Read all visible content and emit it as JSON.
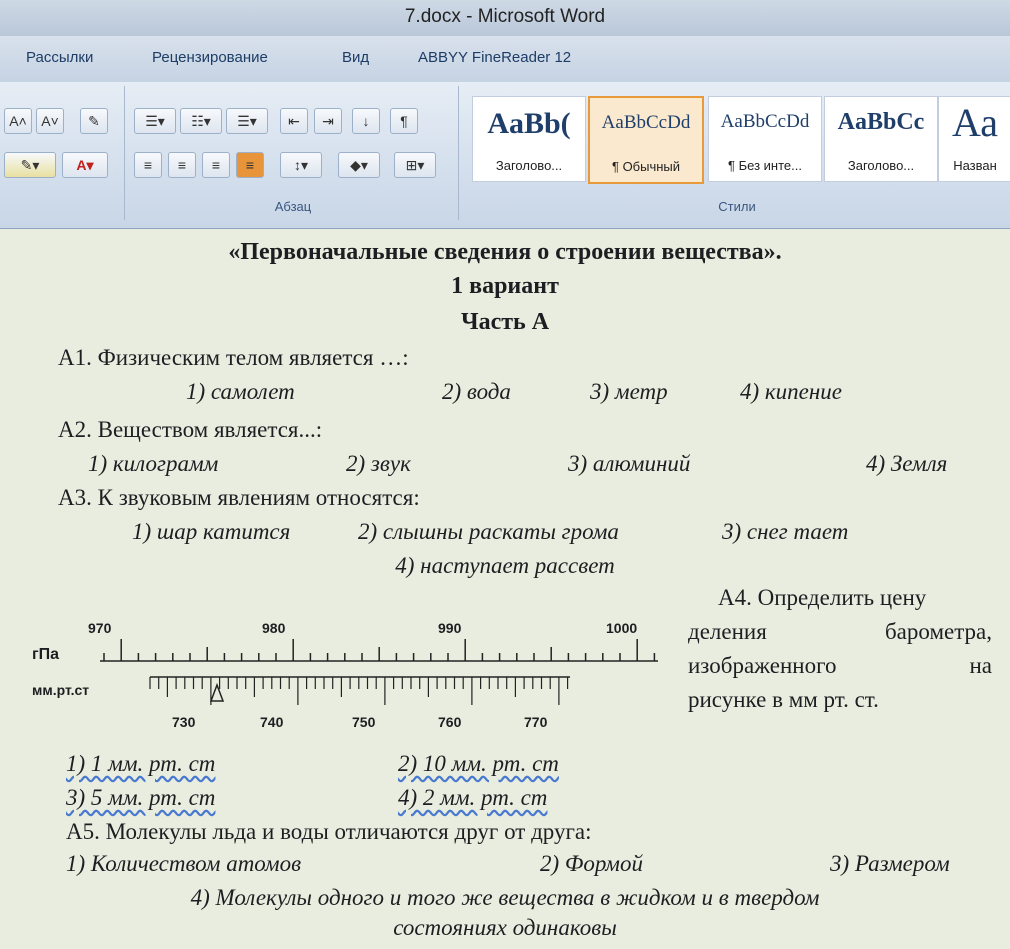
{
  "window": {
    "title": "7.docx - Microsoft Word"
  },
  "ribbon": {
    "tabs": [
      "Рассылки",
      "Рецензирование",
      "Вид",
      "ABBYY FineReader 12"
    ],
    "paragraph_group_label": "Абзац",
    "styles_group_label": "Стили",
    "styles": [
      {
        "preview": "AaBb(",
        "name": "Заголово..."
      },
      {
        "preview": "AaBbCcDd",
        "name": "¶ Обычный"
      },
      {
        "preview": "AaBbCcDd",
        "name": "¶ Без инте..."
      },
      {
        "preview": "AaBbCc",
        "name": "Заголово..."
      },
      {
        "preview": "Аа",
        "name": "Назван"
      }
    ]
  },
  "document": {
    "title": "«Первоначальные сведения о строении вещества».",
    "variant": "1 вариант",
    "part": "Часть А",
    "questions": [
      {
        "label": "А1. Физическим телом является …:",
        "options": [
          "1) самолет",
          "2) вода",
          "3) метр",
          "4) кипение"
        ]
      },
      {
        "label": "А2. Веществом является...:",
        "options": [
          "1) килограмм",
          "2) звук",
          "3) алюминий",
          "4) Земля"
        ]
      },
      {
        "label": "А3. К звуковым явлениям относятся:",
        "options": [
          "1) шар катится",
          "2) слышны раскаты грома",
          "3) снег тает",
          "4) наступает рассвет"
        ]
      },
      {
        "label_lines": [
          "А4. Определить цену",
          "деления барометра,",
          "изображенного на",
          "рисунке в мм рт. ст."
        ],
        "options": [
          "1) 1 мм. рт. ст",
          "2) 10 мм. рт. ст",
          "3) 5 мм. рт. ст",
          "4) 2 мм. рт. ст"
        ]
      },
      {
        "label": "А5. Молекулы льда и воды отличаются друг от друга:",
        "options": [
          "1) Количеством атомов",
          "2) Формой",
          "3) Размером",
          "4) Молекулы одного и того же вещества в жидком и в твердом",
          "состояниях одинаковы"
        ]
      }
    ],
    "barometer": {
      "top_unit": "гПа",
      "bottom_unit": "мм.рт.ст",
      "top_labels": [
        "970",
        "980",
        "990",
        "1000"
      ],
      "bottom_labels": [
        "730",
        "740",
        "750",
        "760",
        "770"
      ]
    }
  }
}
